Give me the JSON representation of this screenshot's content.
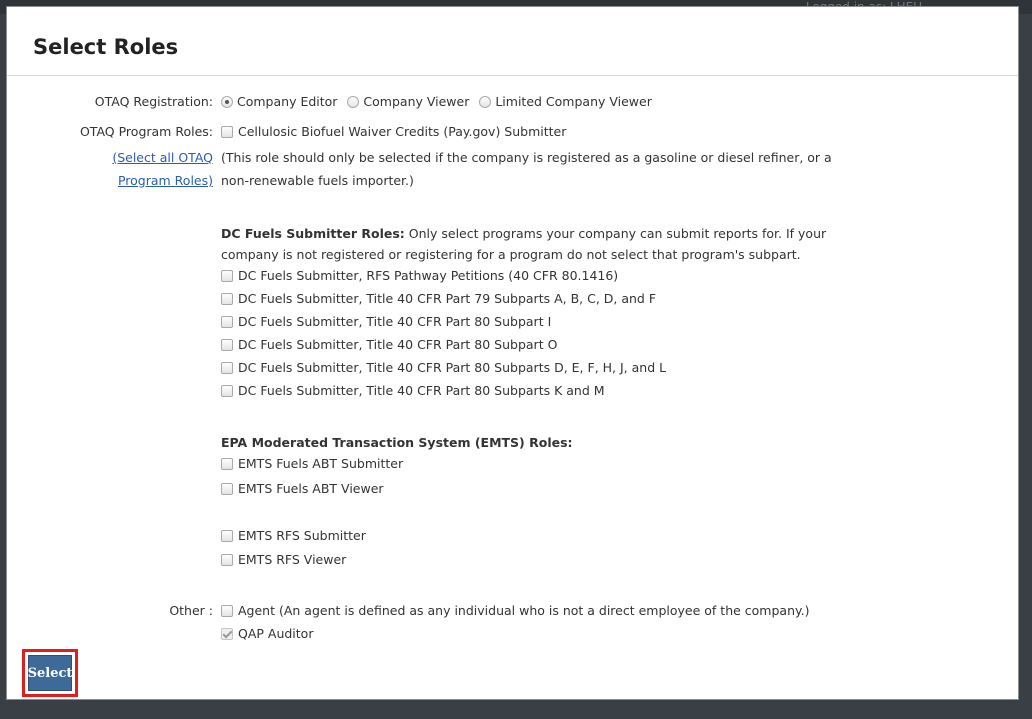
{
  "background": {
    "logged_in": "Logged in as: LHEU"
  },
  "dialog": {
    "title": "Select Roles"
  },
  "registration": {
    "label": "OTAQ Registration:",
    "options": [
      "Company Editor",
      "Company Viewer",
      "Limited Company Viewer"
    ],
    "selected": "Company Editor"
  },
  "program_roles": {
    "label": "OTAQ Program Roles:",
    "select_all_line1": "(Select all OTAQ",
    "select_all_line2": "Program Roles)",
    "cellulosic": "Cellulosic Biofuel Waiver Credits (Pay.gov) Submitter",
    "note_line1": "(This role should only be selected if the company is registered as a gasoline or diesel refiner, or a",
    "note_line2": "non-renewable fuels importer.)"
  },
  "dc_fuels": {
    "heading": "DC Fuels Submitter Roles:",
    "desc_line1": " Only select programs your company can submit reports for. If your",
    "desc_line2": "company is not registered or registering for a program do not select that program's subpart.",
    "items": [
      "DC Fuels Submitter, RFS Pathway Petitions (40 CFR 80.1416)",
      "DC Fuels Submitter, Title 40 CFR Part 79 Subparts A, B, C, D, and F",
      "DC Fuels Submitter, Title 40 CFR Part 80 Subpart I",
      "DC Fuels Submitter, Title 40 CFR Part 80 Subpart O",
      "DC Fuels Submitter, Title 40 CFR Part 80 Subparts D, E, F, H, J, and L",
      "DC Fuels Submitter, Title 40 CFR Part 80 Subparts K and M"
    ]
  },
  "emts": {
    "heading": "EPA Moderated Transaction System (EMTS) Roles:",
    "group1": [
      "EMTS Fuels ABT Submitter",
      "EMTS Fuels ABT Viewer"
    ],
    "group2": [
      "EMTS RFS Submitter",
      "EMTS RFS Viewer"
    ]
  },
  "other": {
    "label": "Other :",
    "agent": "Agent  (An agent is defined as any individual who is not a direct employee of the company.)",
    "qap": "QAP Auditor"
  },
  "footer": {
    "select_label": "Select"
  },
  "colors": {
    "link": "#2a5db0",
    "button": "#3d6a99",
    "highlight": "#e01e1e"
  }
}
